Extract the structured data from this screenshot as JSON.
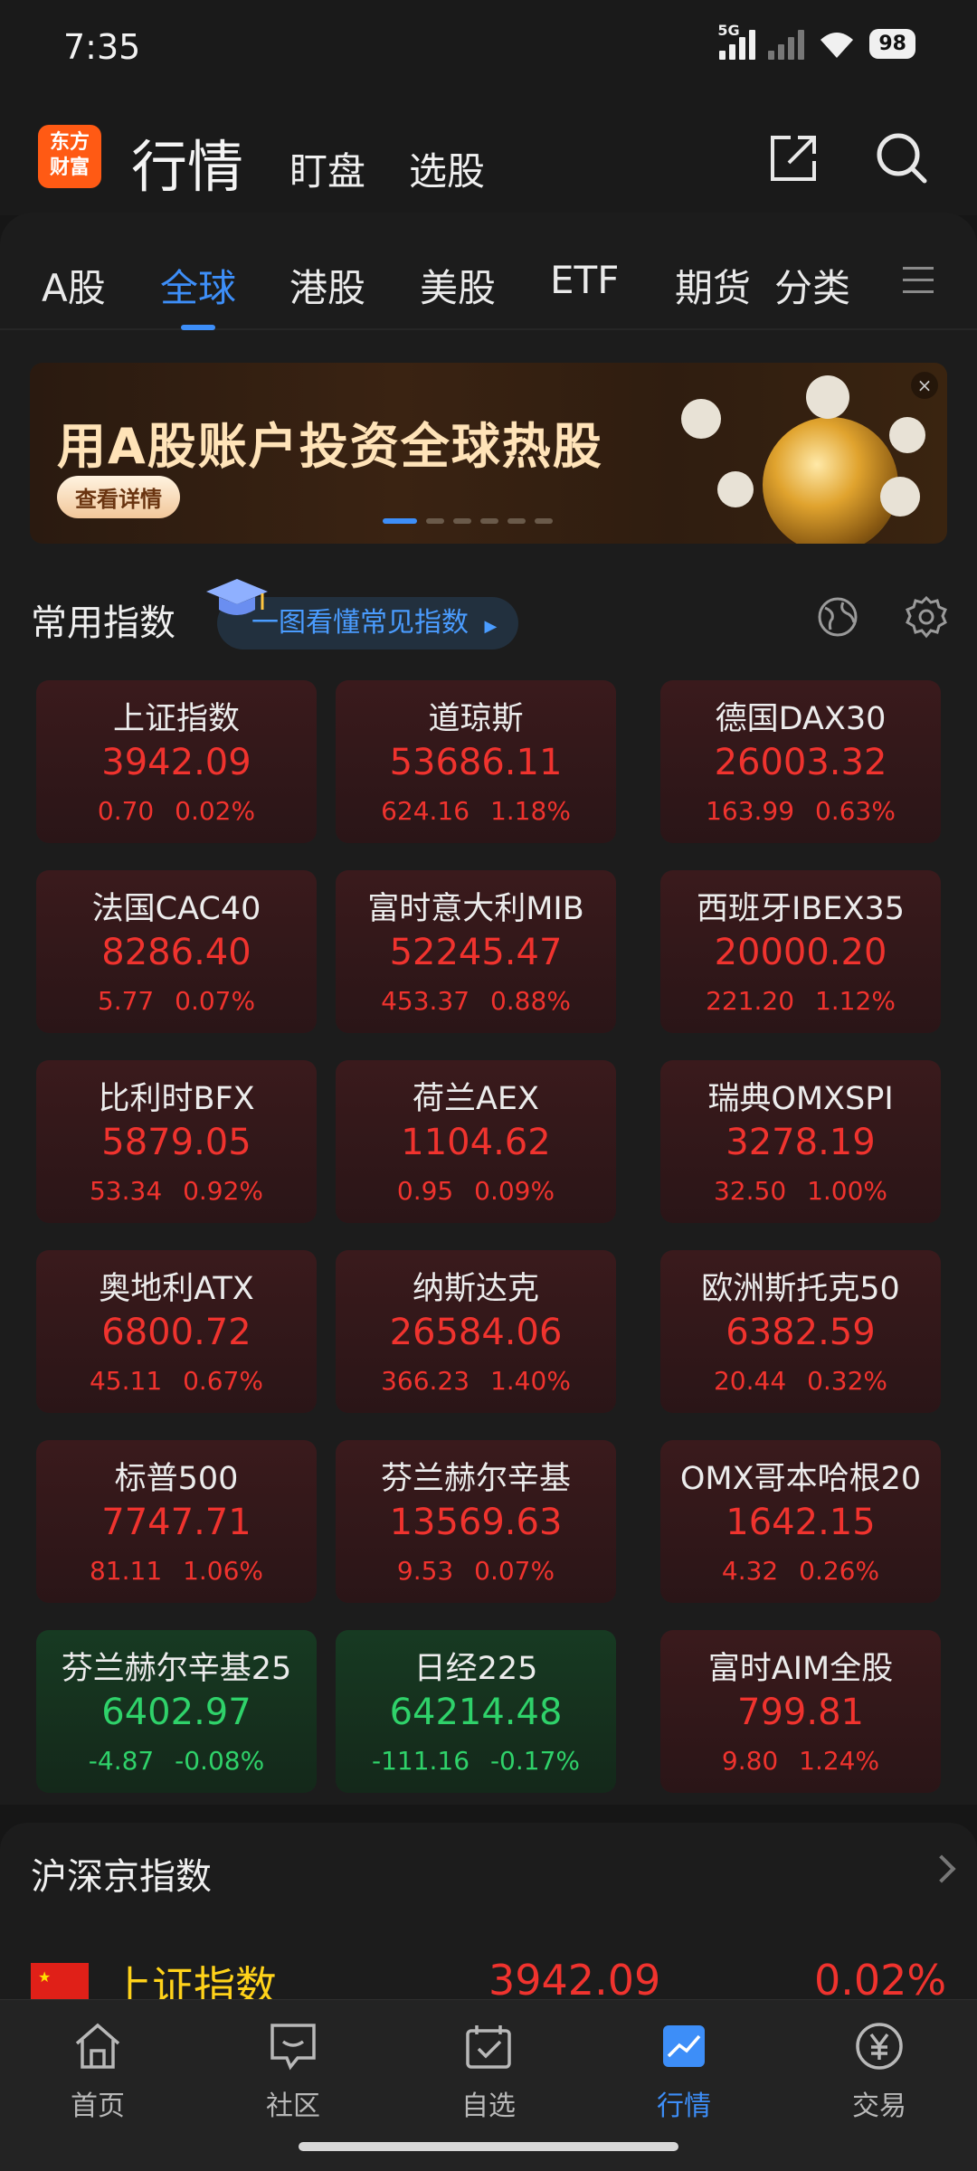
{
  "status_bar": {
    "time": "7:35",
    "network": "5G",
    "battery": "98"
  },
  "header": {
    "logo_line1": "东方",
    "logo_line2": "财富",
    "title": "行情",
    "nav": [
      "盯盘",
      "选股"
    ]
  },
  "tabs": [
    {
      "label": "A股"
    },
    {
      "label": "全球"
    },
    {
      "label": "港股"
    },
    {
      "label": "美股"
    },
    {
      "label": "ETF"
    },
    {
      "label": "期货"
    },
    {
      "label": "分类"
    }
  ],
  "active_tab": "全球",
  "banner": {
    "title": "用A股账户投资全球热股",
    "button": "查看详情",
    "close": "×",
    "slides": 6,
    "active_slide": 1
  },
  "common_indices": {
    "title": "常用指数",
    "guide_link": "一图看懂常见指数",
    "cards": [
      {
        "name": "上证指数",
        "price": "3942.09",
        "change": "0.70",
        "pct": "0.02%",
        "direction": "up"
      },
      {
        "name": "道琼斯",
        "price": "53686.11",
        "change": "624.16",
        "pct": "1.18%",
        "direction": "up"
      },
      {
        "name": "德国DAX30",
        "price": "26003.32",
        "change": "163.99",
        "pct": "0.63%",
        "direction": "up"
      },
      {
        "name": "法国CAC40",
        "price": "8286.40",
        "change": "5.77",
        "pct": "0.07%",
        "direction": "up"
      },
      {
        "name": "富时意大利MIB",
        "price": "52245.47",
        "change": "453.37",
        "pct": "0.88%",
        "direction": "up"
      },
      {
        "name": "西班牙IBEX35",
        "price": "20000.20",
        "change": "221.20",
        "pct": "1.12%",
        "direction": "up"
      },
      {
        "name": "比利时BFX",
        "price": "5879.05",
        "change": "53.34",
        "pct": "0.92%",
        "direction": "up"
      },
      {
        "name": "荷兰AEX",
        "price": "1104.62",
        "change": "0.95",
        "pct": "0.09%",
        "direction": "up"
      },
      {
        "name": "瑞典OMXSPI",
        "price": "3278.19",
        "change": "32.50",
        "pct": "1.00%",
        "direction": "up"
      },
      {
        "name": "奥地利ATX",
        "price": "6800.72",
        "change": "45.11",
        "pct": "0.67%",
        "direction": "up"
      },
      {
        "name": "纳斯达克",
        "price": "26584.06",
        "change": "366.23",
        "pct": "1.40%",
        "direction": "up"
      },
      {
        "name": "欧洲斯托克50",
        "price": "6382.59",
        "change": "20.44",
        "pct": "0.32%",
        "direction": "up"
      },
      {
        "name": "标普500",
        "price": "7747.71",
        "change": "81.11",
        "pct": "1.06%",
        "direction": "up"
      },
      {
        "name": "芬兰赫尔辛基",
        "price": "13569.63",
        "change": "9.53",
        "pct": "0.07%",
        "direction": "up"
      },
      {
        "name": "OMX哥本哈根20",
        "price": "1642.15",
        "change": "4.32",
        "pct": "0.26%",
        "direction": "up"
      },
      {
        "name": "芬兰赫尔辛基25",
        "price": "6402.97",
        "change": "-4.87",
        "pct": "-0.08%",
        "direction": "down"
      },
      {
        "name": "日经225",
        "price": "64214.48",
        "change": "-111.16",
        "pct": "-0.17%",
        "direction": "down"
      },
      {
        "name": "富时AIM全股",
        "price": "799.81",
        "change": "9.80",
        "pct": "1.24%",
        "direction": "up"
      }
    ]
  },
  "domestic": {
    "title": "沪深京指数",
    "first_row": {
      "name": "上证指数",
      "price": "3942.09",
      "pct": "0.02%"
    }
  },
  "bottom_nav": [
    {
      "label": "首页",
      "icon": "home-icon"
    },
    {
      "label": "社区",
      "icon": "community-icon"
    },
    {
      "label": "自选",
      "icon": "watchlist-icon"
    },
    {
      "label": "行情",
      "icon": "market-icon"
    },
    {
      "label": "交易",
      "icon": "trade-icon"
    }
  ],
  "colors": {
    "up": "#f0332e",
    "down": "#2fd26a",
    "accent": "#3d8ef8",
    "brand": "#ff5a14"
  }
}
